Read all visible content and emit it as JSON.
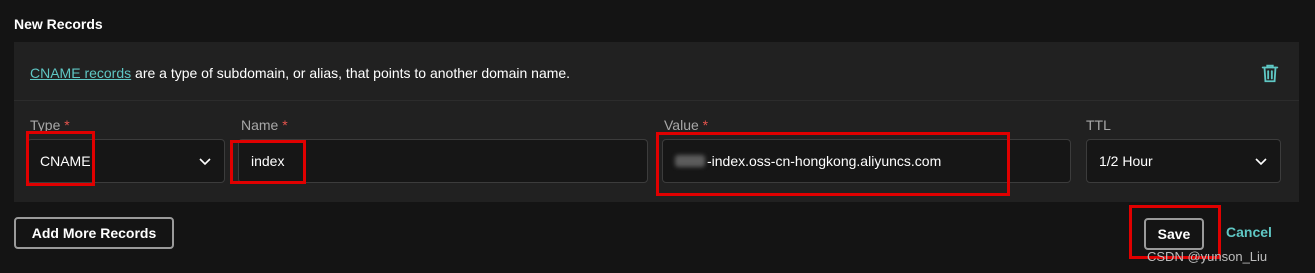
{
  "section_title": "New Records",
  "info": {
    "link_text": "CNAME records",
    "text": " are a type of subdomain, or alias, that points to another domain name."
  },
  "icons": {
    "trash": "trash-icon",
    "chevron": "chevron-down-icon"
  },
  "fields": {
    "type": {
      "label": "Type",
      "required_marker": "*",
      "value": "CNAME"
    },
    "name": {
      "label": "Name",
      "required_marker": "*",
      "value": "index"
    },
    "value": {
      "label": "Value",
      "required_marker": "*",
      "value": "-index.oss-cn-hongkong.aliyuncs.com"
    },
    "ttl": {
      "label": "TTL",
      "value": "1/2 Hour"
    }
  },
  "buttons": {
    "add_more": "Add More Records",
    "save": "Save",
    "cancel": "Cancel"
  },
  "watermark": "CSDN @yunson_Liu",
  "colors": {
    "accent": "#5fc7c4",
    "required": "#e5544d",
    "highlight": "#e00000",
    "background": "#141414",
    "panel": "#212121"
  }
}
